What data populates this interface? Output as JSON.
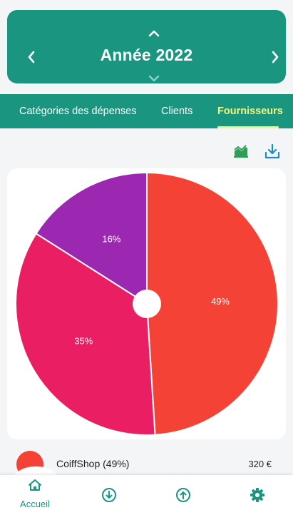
{
  "header": {
    "year_title": "Année 2022",
    "prev_icon": "chevron-left-icon",
    "next_icon": "chevron-right-icon",
    "up_icon": "chevron-up-icon",
    "down_icon": "chevron-down-icon",
    "bg_color": "#1a9680"
  },
  "tabs": [
    {
      "label": "Catégories des dépenses",
      "active": false
    },
    {
      "label": "Clients",
      "active": false
    },
    {
      "label": "Fournisseurs",
      "active": true
    }
  ],
  "toolbar": {
    "chart_icon": "area-chart-icon",
    "download_icon": "download-icon"
  },
  "chart_data": {
    "type": "pie",
    "title": "",
    "slices": [
      {
        "label": "49%",
        "value": 49,
        "color": "#f44336"
      },
      {
        "label": "35%",
        "value": 35,
        "color": "#e91e63"
      },
      {
        "label": "16%",
        "value": 16,
        "color": "#9c27b0"
      }
    ]
  },
  "list": {
    "items": [
      {
        "name": "CoiffShop (49%)",
        "amount": "320 €",
        "color": "#f44336"
      }
    ]
  },
  "bottom_nav": {
    "home_label": "Accueil",
    "home_icon": "home-icon",
    "income_icon": "arrow-down-circle-icon",
    "expense_icon": "arrow-up-circle-icon",
    "settings_icon": "gear-icon"
  }
}
